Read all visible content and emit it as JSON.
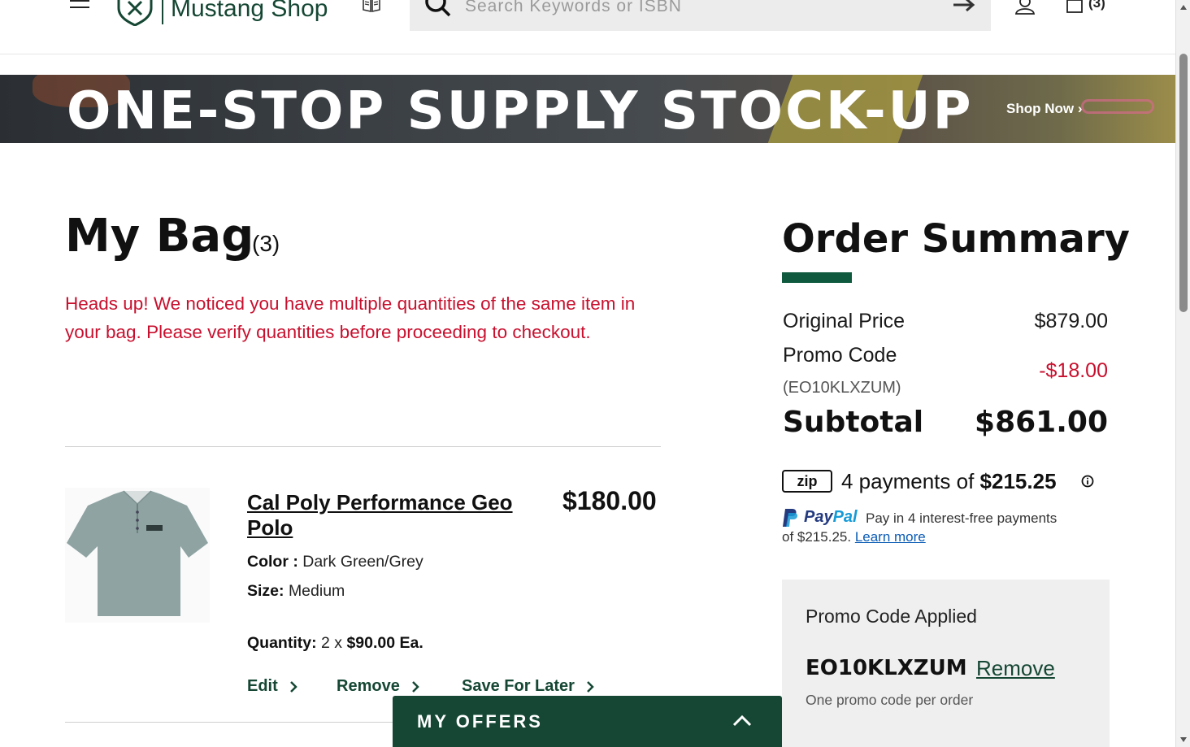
{
  "header": {
    "logo_text": "Mustang Shop",
    "search_placeholder": "Search Keywords or ISBN",
    "bag_count": "(3)"
  },
  "banner": {
    "title": "ONE-STOP SUPPLY STOCK-UP",
    "cta": "Shop Now ›"
  },
  "bag": {
    "title": "My Bag",
    "count": "(3)",
    "warning": "Heads up! We noticed you have multiple quantities of the same item in your bag. Please verify quantities before proceeding to checkout."
  },
  "item": {
    "name": "Cal Poly Performance Geo Polo",
    "price": "$180.00",
    "color_label": "Color :",
    "color_value": "Dark Green/Grey",
    "size_label": "Size:",
    "size_value": "Medium",
    "qty_label": "Quantity:",
    "qty_value": "2 x",
    "unit_price": "$90.00 Ea.",
    "actions": {
      "edit": "Edit",
      "remove": "Remove",
      "save": "Save For Later"
    }
  },
  "offers": {
    "label": "MY OFFERS"
  },
  "summary": {
    "title": "Order Summary",
    "original_label": "Original Price",
    "original_value": "$879.00",
    "promo_label": "Promo Code",
    "promo_code_paren": "(EO10KLXZUM)",
    "promo_value": "-$18.00",
    "subtotal_label": "Subtotal",
    "subtotal_value": "$861.00",
    "zip_badge": "zip",
    "zip_prefix": "4 payments of",
    "zip_amount": "$215.25",
    "paypal_word_1": "Pay",
    "paypal_word_2": "Pal",
    "paypal_line1": "Pay in 4 interest-free payments",
    "paypal_line2": "of $215.25.",
    "paypal_learn": "Learn more"
  },
  "promo": {
    "applied": "Promo Code Applied",
    "code": "EO10KLXZUM",
    "remove": "Remove",
    "note": "One promo code per order"
  },
  "colors": {
    "brand_green": "#154734",
    "accent_green": "#0f5a3e",
    "warning_red": "#c8102e"
  }
}
